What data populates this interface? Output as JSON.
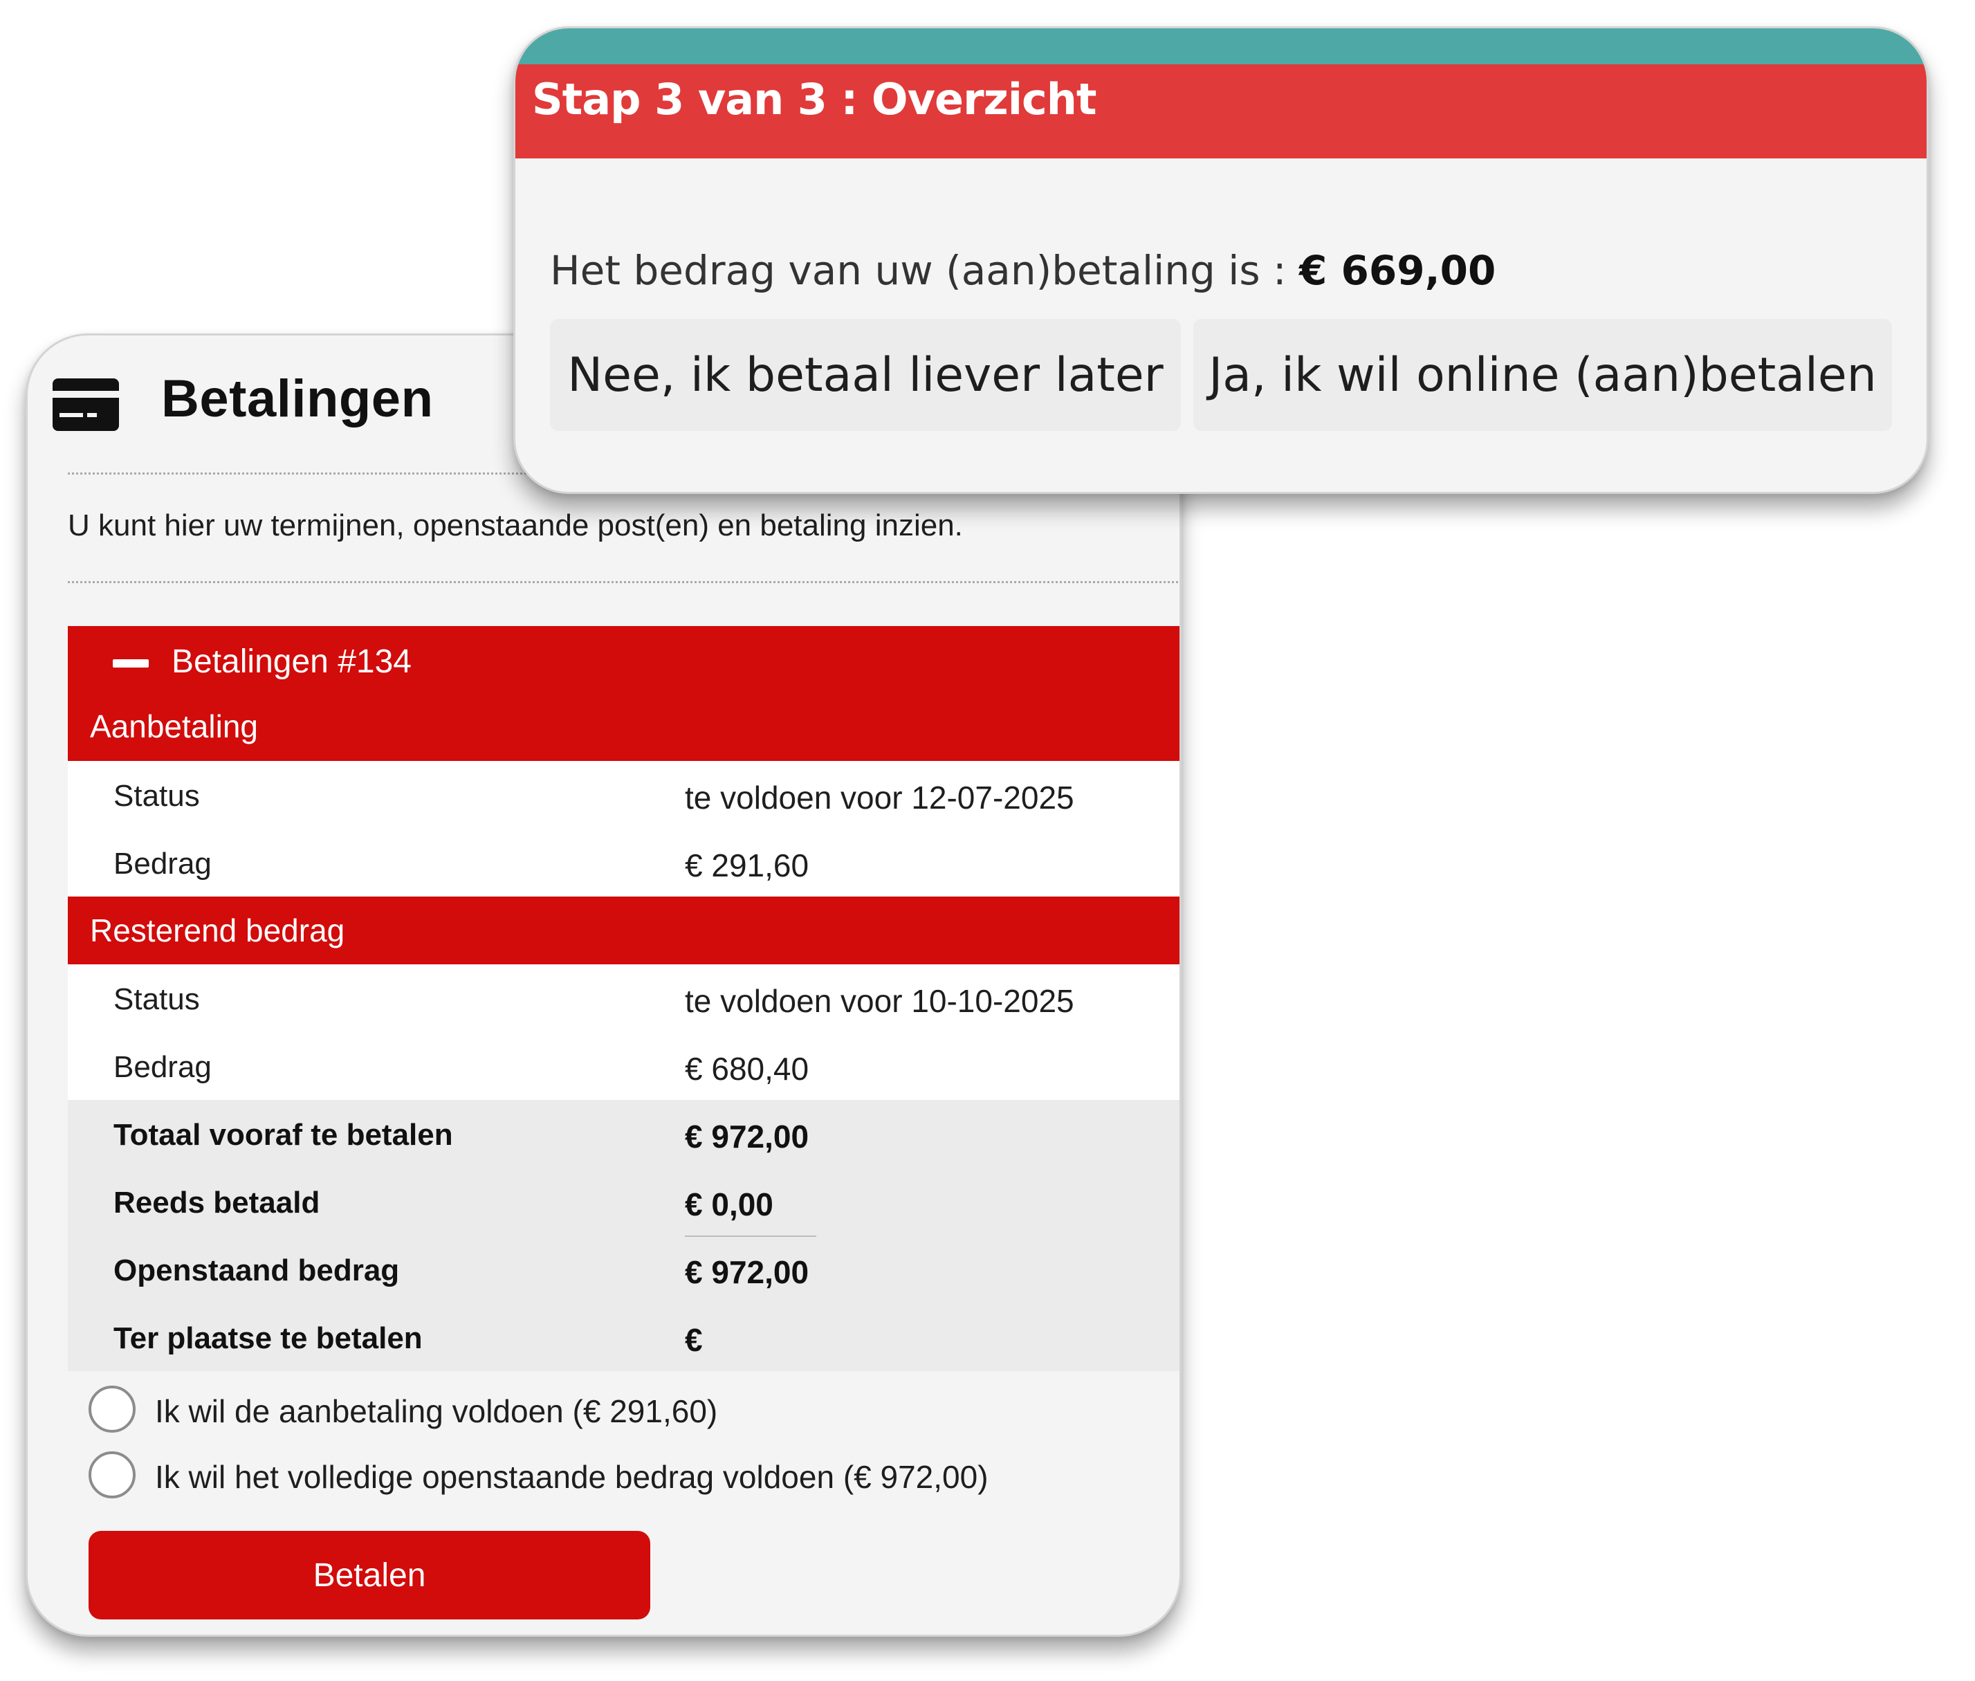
{
  "payments": {
    "title": "Betalingen",
    "intro": "U kunt hier uw termijnen, openstaande post(en) en betaling inzien.",
    "panel_title": "Betalingen #134",
    "sections": [
      {
        "label": "Aanbetaling",
        "rows": [
          {
            "key": "Status",
            "value": "te voldoen voor 12-07-2025"
          },
          {
            "key": "Bedrag",
            "value": "€ 291,60"
          }
        ]
      },
      {
        "label": "Resterend bedrag",
        "rows": [
          {
            "key": "Status",
            "value": "te voldoen voor 10-10-2025"
          },
          {
            "key": "Bedrag",
            "value": "€ 680,40"
          }
        ]
      }
    ],
    "totals": [
      {
        "key": "Totaal vooraf te betalen",
        "value": "€ 972,00"
      },
      {
        "key": "Reeds betaald",
        "value": "€ 0,00"
      },
      {
        "key": "Openstaand bedrag",
        "value": "€ 972,00"
      },
      {
        "key": "Ter plaatse te betalen",
        "value": "€"
      }
    ],
    "options": [
      {
        "label": "Ik wil de aanbetaling voldoen (€ 291,60)",
        "selected": false
      },
      {
        "label": "Ik wil het volledige openstaande bedrag voldoen (€ 972,00)",
        "selected": false
      }
    ],
    "pay_button": "Betalen",
    "icon": "credit-card-icon"
  },
  "step_dialog": {
    "title": "Stap 3 van 3 : Overzicht",
    "amount_prefix": "Het bedrag van uw (aan)betaling is : ",
    "amount_value": "€ 669,00",
    "later_button": "Nee, ik betaal liever later",
    "online_button": "Ja, ik wil online (aan)betalen"
  },
  "colors": {
    "primary_red": "#d20b0b",
    "dialog_red": "#e13a3a",
    "teal": "#4ea9a6",
    "card_bg": "#f4f4f4"
  }
}
